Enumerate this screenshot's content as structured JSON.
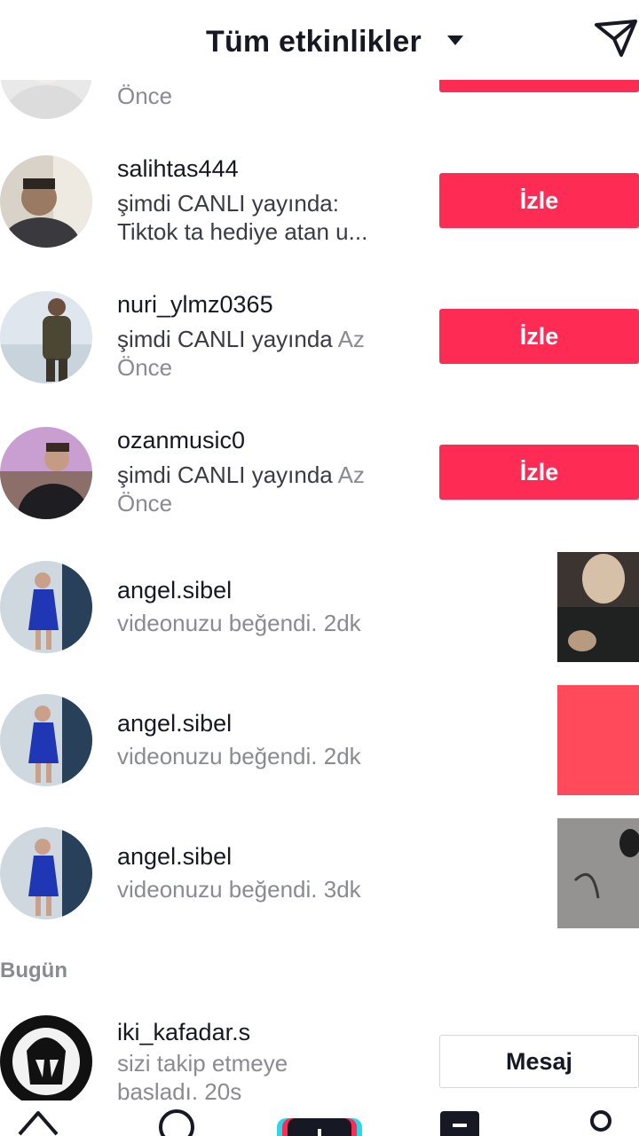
{
  "header": {
    "title": "Tüm etkinlikler",
    "caret_icon": "caret-down-icon",
    "send_icon": "send-icon"
  },
  "top_partial": {
    "desc_tail": "Önce"
  },
  "live_rows": [
    {
      "username": "salihtas444",
      "line1": "şimdi CANLI yayında:",
      "line2": "Tiktok ta  hediye atan u...",
      "button": "İzle"
    },
    {
      "username": "nuri_ylmz0365",
      "line1": "şimdi CANLI yayında",
      "time": "Az",
      "line2": "Önce",
      "button": "İzle"
    },
    {
      "username": "ozanmusic0",
      "line1": "şimdi CANLI yayında",
      "time": "Az",
      "line2": "Önce",
      "button": "İzle"
    }
  ],
  "like_rows": [
    {
      "username": "angel.sibel",
      "action": "videonuzu beğendi.",
      "time": "2dk"
    },
    {
      "username": "angel.sibel",
      "action": "videonuzu beğendi.",
      "time": "2dk"
    },
    {
      "username": "angel.sibel",
      "action": "videonuzu beğendi.",
      "time": "3dk"
    }
  ],
  "section": {
    "today": "Bugün"
  },
  "follow_row": {
    "username": "iki_kafadar.s",
    "line1": "sizi takip etmeye",
    "line2": "başladı. 20s",
    "button": "Mesaj"
  },
  "tabbar": {
    "icons": [
      "home-icon",
      "discover-icon",
      "create-icon",
      "inbox-icon",
      "profile-icon"
    ]
  },
  "colors": {
    "accent": "#fe2c55",
    "text": "#161823",
    "muted": "#8a8b91"
  }
}
